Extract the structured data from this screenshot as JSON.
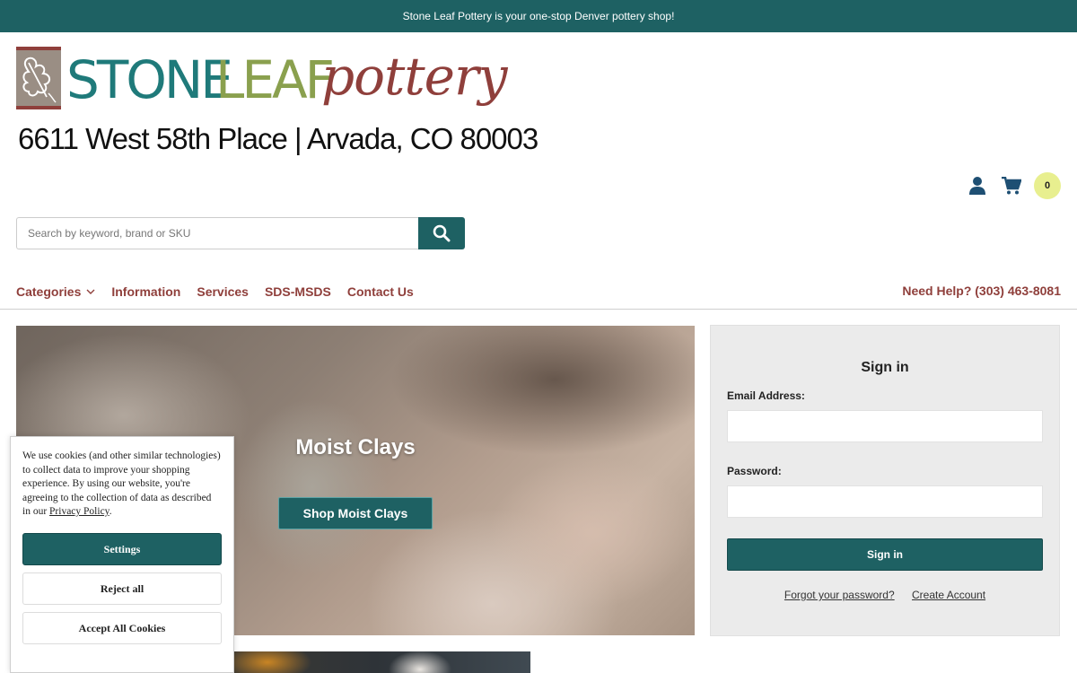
{
  "announcement": "Stone Leaf Pottery is your one-stop Denver pottery shop!",
  "logo": {
    "word1": "STONE",
    "word2": "LEAF",
    "word3": "pottery",
    "address": "6611 West 58th Place  |  Arvada, CO 80003"
  },
  "header": {
    "account_icon": "user-icon",
    "cart_icon": "shopping-cart-icon",
    "cart_count": "0"
  },
  "search": {
    "placeholder": "Search by keyword, brand or SKU",
    "button_icon": "search-icon"
  },
  "nav": {
    "items": [
      {
        "label": "Categories"
      },
      {
        "label": "Information"
      },
      {
        "label": "Services"
      },
      {
        "label": "SDS-MSDS"
      },
      {
        "label": "Contact Us"
      }
    ],
    "help": "Need Help? (303) 463-8081"
  },
  "hero": {
    "title": "Moist Clays",
    "button": "Shop Moist Clays"
  },
  "signin": {
    "title": "Sign in",
    "email_label": "Email Address:",
    "password_label": "Password:",
    "submit": "Sign in",
    "forgot": "Forgot your password?",
    "create": "Create Account"
  },
  "cookie": {
    "text": "We use cookies (and other similar technologies) to collect data to improve your shopping experience. By using our website, you're agreeing to the collection of data as described in our ",
    "link": "Privacy Policy",
    "text_end": ".",
    "settings": "Settings",
    "reject": "Reject all",
    "accept": "Accept All Cookies"
  },
  "colors": {
    "brand_teal": "#1e6163",
    "brand_red": "#8f3f3b",
    "logo_green": "#8aa04e",
    "cart_badge": "#e8ef8f"
  }
}
